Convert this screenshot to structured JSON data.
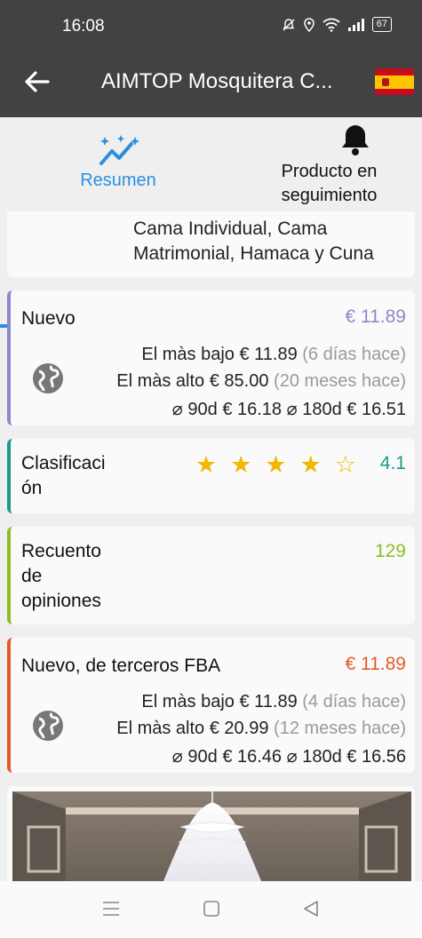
{
  "status_bar": {
    "time": "16:08",
    "battery": "67"
  },
  "app_bar": {
    "title": "AIMTOP Mosquitera C..."
  },
  "tabs": [
    {
      "label": "Resumen"
    },
    {
      "label": "Producto en seguimiento"
    }
  ],
  "description_card": {
    "text_line1": "Cama Individual, Cama",
    "text_line2": "Matrimonial, Hamaca y Cuna"
  },
  "new_price": {
    "label": "Nuevo",
    "current": "€ 11.89",
    "lowest_label": "El màs bajo",
    "lowest_value": "€ 11.89",
    "lowest_when": "(6 días hace)",
    "highest_label": "El màs alto",
    "highest_value": "€ 85.00",
    "highest_when": "(20 meses hace)",
    "avg_90_label": "⌀ 90d",
    "avg_90_value": "€ 16.18",
    "avg_180_label": "⌀ 180d",
    "avg_180_value": "€ 16.51",
    "accent_color": "#8e87cc"
  },
  "rating": {
    "label_line1": "Clasificaci",
    "label_line2": "ón",
    "value": "4.1",
    "stars_filled": 4,
    "stars_total": 5,
    "accent_color": "#1a9a8a"
  },
  "reviews": {
    "label_line1": "Recuento",
    "label_line2": "de",
    "label_line3": "opiniones",
    "value": "129",
    "accent_color": "#8cbf26"
  },
  "fba_price": {
    "label": "Nuevo, de terceros FBA",
    "current": "€ 11.89",
    "lowest_label": "El màs bajo",
    "lowest_value": "€ 11.89",
    "lowest_when": "(4 días hace)",
    "highest_label": "El màs alto",
    "highest_value": "€ 20.99",
    "highest_when": "(12 meses hace)",
    "avg_90_label": "⌀ 90d",
    "avg_90_value": "€ 16.46",
    "avg_180_label": "⌀ 180d",
    "avg_180_value": "€ 16.56",
    "accent_color": "#e8582a"
  },
  "icons": [
    "back-arrow-icon",
    "spain-flag-icon",
    "trend-sparkle-icon",
    "bell-icon",
    "globe-icon",
    "star-icon",
    "menu-icon",
    "home-square-icon",
    "back-triangle-icon"
  ]
}
